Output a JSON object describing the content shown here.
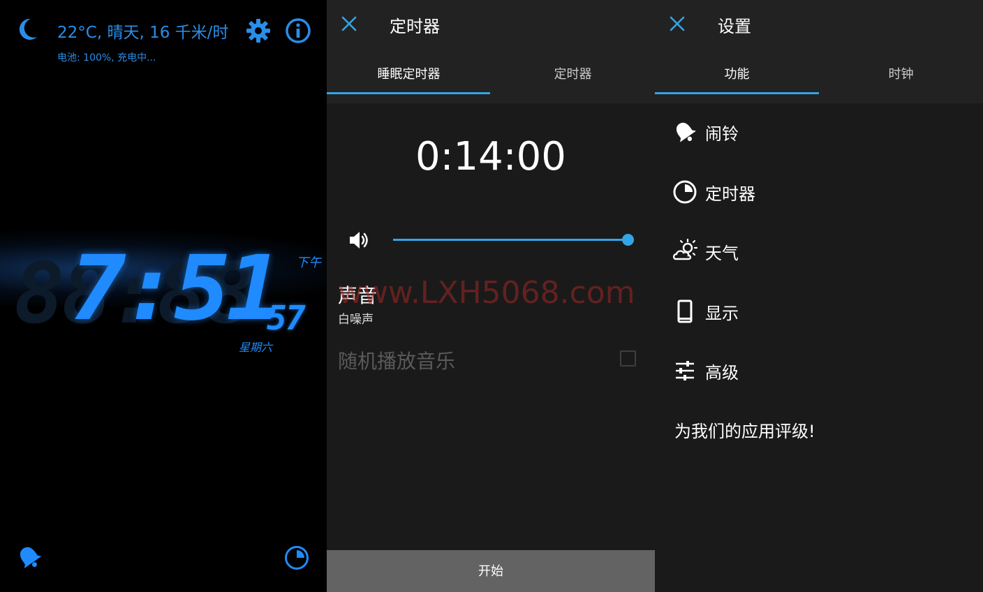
{
  "clock": {
    "weather_line": "22°C, 晴天, 16 千米/时",
    "battery_line": "电池: 100%, 充电中...",
    "time_hm": "7:51",
    "time_sec": "57",
    "ghost_digits": "88:88",
    "ampm": "下午",
    "weekday": "星期六",
    "accent_color": "#1f8bff",
    "icons": [
      "moon-icon",
      "gear-icon",
      "info-icon",
      "bell-icon",
      "timer-icon"
    ]
  },
  "timer_panel": {
    "title": "定时器",
    "tabs": [
      {
        "label": "睡眠定时器",
        "active": true
      },
      {
        "label": "定时器",
        "active": false
      }
    ],
    "countdown": "0:14:00",
    "volume_fraction": 1.0,
    "sound_title": "声音",
    "sound_value": "白噪声",
    "shuffle_label": "随机播放音乐",
    "shuffle_checked": false,
    "watermark": "www.LXH5068.com",
    "start_label": "开始",
    "accent_color": "#33a5e5"
  },
  "settings_panel": {
    "title": "设置",
    "tabs": [
      {
        "label": "功能",
        "active": true
      },
      {
        "label": "时钟",
        "active": false
      }
    ],
    "items": [
      {
        "label": "闹铃",
        "icon": "bell-icon"
      },
      {
        "label": "定时器",
        "icon": "timer-icon"
      },
      {
        "label": "天气",
        "icon": "weather-icon"
      },
      {
        "label": "显示",
        "icon": "phone-icon"
      },
      {
        "label": "高级",
        "icon": "sliders-icon"
      }
    ],
    "rate_label": "为我们的应用评级!"
  }
}
